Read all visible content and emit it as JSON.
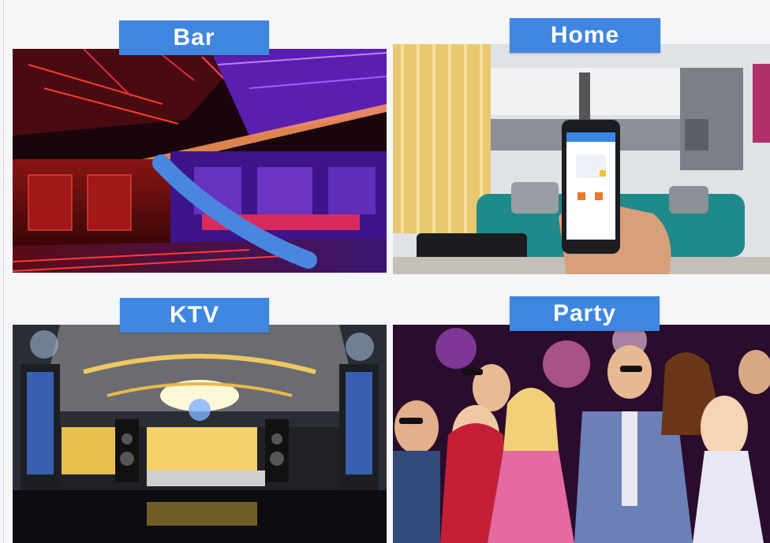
{
  "panels": {
    "bar": {
      "label": "Bar"
    },
    "home": {
      "label": "Home"
    },
    "ktv": {
      "label": "KTV"
    },
    "party": {
      "label": "Party"
    }
  },
  "colors": {
    "label_bg": "#3f86e0",
    "label_text": "#ffffff",
    "led_strip": "#4a86e0",
    "sofa": "#1f8a8a"
  },
  "icons": [
    "led-strip-icon",
    "smartphone-icon",
    "chandelier-icon",
    "disco-light-icon"
  ]
}
